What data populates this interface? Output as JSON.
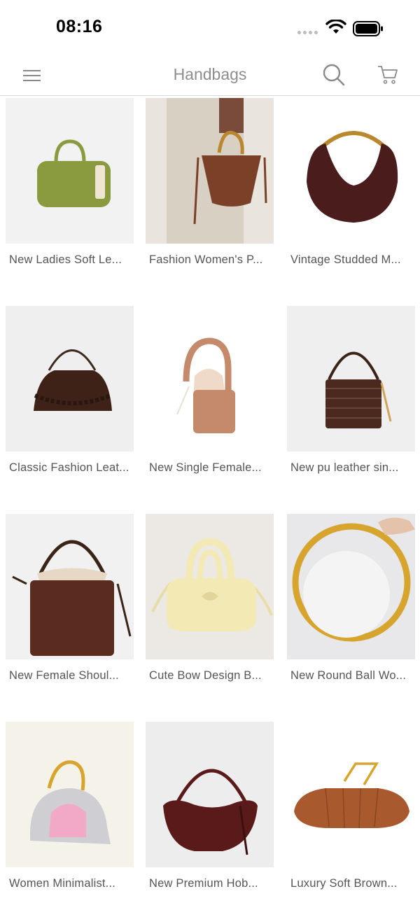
{
  "status_bar": {
    "time": "08:16"
  },
  "header": {
    "title": "Handbags"
  },
  "products": [
    {
      "title": "New Ladies Soft Le...",
      "bg": "#f2f2f2",
      "color": "#8a9a3e",
      "style": "boston",
      "icon": "handbag-image"
    },
    {
      "title": "Fashion Women's P...",
      "bg": "#e9e4de",
      "color": "#7a4128",
      "style": "bucket-model",
      "icon": "handbag-image"
    },
    {
      "title": "Vintage Studded M...",
      "bg": "#ffffff",
      "color": "#4a1c1c",
      "style": "hobo",
      "icon": "handbag-image"
    },
    {
      "title": "Classic Fashion Leat...",
      "bg": "#efefef",
      "color": "#3e2217",
      "style": "pouch",
      "icon": "handbag-image"
    },
    {
      "title": "New Single Female...",
      "bg": "#ffffff",
      "color": "#c48a6b",
      "style": "cylinder",
      "icon": "handbag-image"
    },
    {
      "title": "New pu leather sin...",
      "bg": "#efefef",
      "color": "#4a2a1e",
      "style": "woven-bucket",
      "icon": "handbag-image"
    },
    {
      "title": "New Female Shoul...",
      "bg": "#f1f1f1",
      "color": "#5a2c1f",
      "style": "drawstring-bucket",
      "icon": "handbag-image"
    },
    {
      "title": "Cute Bow Design B...",
      "bg": "#ece9e4",
      "color": "#f3e9b5",
      "style": "bow-bag",
      "icon": "handbag-image"
    },
    {
      "title": "New Round Ball Wo...",
      "bg": "#e8e8ea",
      "color": "#f4f4f4",
      "style": "ball",
      "icon": "handbag-image"
    },
    {
      "title": "Women Minimalist...",
      "bg": "#f5f2ea",
      "color": "#cfcfd3",
      "style": "silver-dome",
      "icon": "handbag-image"
    },
    {
      "title": "New Premium Hob...",
      "bg": "#ededed",
      "color": "#5a1a1a",
      "style": "premium-hobo",
      "icon": "handbag-image"
    },
    {
      "title": "Luxury Soft Brown...",
      "bg": "#ffffff",
      "color": "#a85a2e",
      "style": "pleated-clutch",
      "icon": "handbag-image"
    }
  ]
}
